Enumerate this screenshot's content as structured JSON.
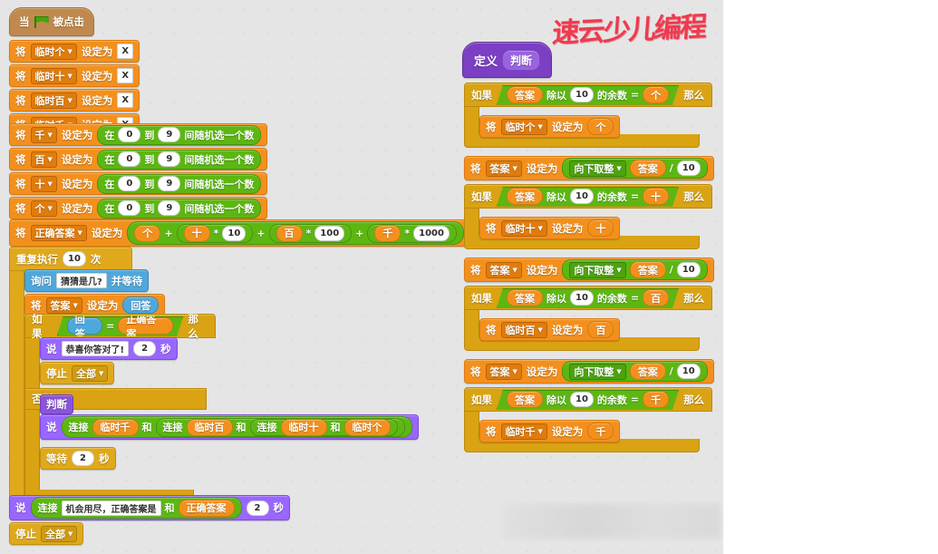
{
  "watermark": {
    "text": "速云少儿编程",
    "color": "#ef3a4e"
  },
  "palette": {
    "canvas_bg": "#e5e5e5",
    "data_orange": "#f3901d",
    "control_gold": "#e0a91c",
    "looks_purple": "#9966ff",
    "sensing_blue": "#4fa8dc",
    "operator_green": "#5cb712",
    "more_purple": "#8a55d7",
    "hat_brown": "#c08a4e"
  },
  "script_main": {
    "hat": {
      "when": "当",
      "clicked": "被点击",
      "flag_icon": "green-flag-icon"
    },
    "set_word": "将",
    "to_word": "设定为",
    "init_sets": [
      {
        "var": "临时个",
        "value": "X"
      },
      {
        "var": "临时十",
        "value": "X"
      },
      {
        "var": "临时百",
        "value": "X"
      },
      {
        "var": "临时千",
        "value": "X"
      }
    ],
    "random_label_pre": "在",
    "random_label_mid": "到",
    "random_label_post": "间随机选一个数",
    "random_min": "0",
    "random_max": "9",
    "random_sets": [
      {
        "var": "千"
      },
      {
        "var": "百"
      },
      {
        "var": "十"
      },
      {
        "var": "个"
      }
    ],
    "answer_calc": {
      "var": "正确答案",
      "terms": [
        {
          "name": "个",
          "mult": null
        },
        {
          "name": "十",
          "mult": "10"
        },
        {
          "name": "百",
          "mult": "100"
        },
        {
          "name": "千",
          "mult": "1000"
        }
      ],
      "plus": "+",
      "times": "*"
    },
    "repeat": {
      "pre": "重复执行",
      "count": "10",
      "post": "次"
    },
    "ask": {
      "label": "询问",
      "question": "猜猜是几?",
      "wait": "并等待"
    },
    "set_answer": {
      "var": "答案",
      "reporter": "回答"
    },
    "if_block": {
      "if": "如果",
      "then": "那么",
      "else": "否则"
    },
    "compare": {
      "left": "回答",
      "op": "=",
      "right": "正确答案"
    },
    "say_correct": {
      "label": "说",
      "text": "恭喜你答对了!",
      "secs": "2",
      "secs_unit": "秒"
    },
    "stop_inner": {
      "label": "停止",
      "option": "全部"
    },
    "call_judge": "判断",
    "say_join": {
      "label": "说",
      "join": "连接",
      "and": "和",
      "parts": [
        "临时千",
        "临时百",
        "临时十",
        "临时个"
      ]
    },
    "wait_block": {
      "label": "等待",
      "secs": "2",
      "unit": "秒"
    },
    "say_final": {
      "label": "说",
      "join": "连接",
      "text": "机会用尽，正确答案是",
      "and": "和",
      "var": "正确答案",
      "secs": "2",
      "unit": "秒"
    },
    "stop_final": {
      "label": "停止",
      "option": "全部"
    }
  },
  "script_define": {
    "define": {
      "label": "定义",
      "name": "判断"
    },
    "if": "如果",
    "then": "那么",
    "set_word": "将",
    "to_word": "设定为",
    "mod": {
      "left": "答案",
      "pre": "除以",
      "divisor": "10",
      "post": "的余数",
      "eq": "="
    },
    "floor": {
      "func": "向下取整",
      "var": "答案",
      "div": "/",
      "by": "10"
    },
    "answer_var": "答案",
    "branches": [
      {
        "digit": "个",
        "tempvar": "临时个"
      },
      {
        "digit": "十",
        "tempvar": "临时十"
      },
      {
        "digit": "百",
        "tempvar": "临时百"
      },
      {
        "digit": "千",
        "tempvar": "临时千"
      }
    ]
  }
}
